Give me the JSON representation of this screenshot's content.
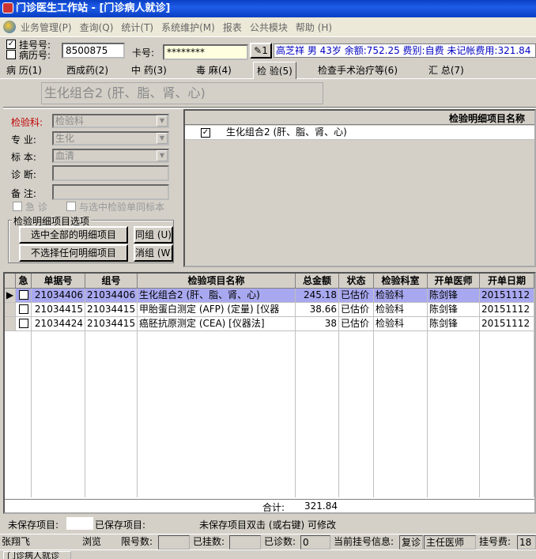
{
  "window": {
    "title": "门诊医生工作站 - [门诊病人就诊]"
  },
  "menu": [
    "业务管理(P)",
    "查询(Q)",
    "统计(T)",
    "系统维护(M)",
    "报表",
    "公共模块",
    "帮助 (H)"
  ],
  "patient": {
    "reg_label": "挂号号:",
    "record_label": "病历号:",
    "record_value": "8500875",
    "card_label": "卡号:",
    "card_value": "********",
    "card_btn": "1",
    "info": "高芝祥 男 43岁 余额:752.25 费别:自费 未记帐费用:321.84"
  },
  "tabs": [
    "病 历(1)",
    "西成药(2)",
    "中 药(3)",
    "毒 麻(4)",
    "检 验(5)",
    "检查手术治疗等(6)",
    "汇 总(7)"
  ],
  "active_tab": 4,
  "current_item_title": "生化组合2 (肝、脂、肾、心)",
  "form": {
    "dept_label": "检验科:",
    "dept_value": "检验科",
    "specialty_label": "专  业:",
    "specialty_value": "生化",
    "specimen_label": "标  本:",
    "specimen_value": "血清",
    "diagnosis_label": "诊  断:",
    "diagnosis_value": "",
    "remark_label": "备  注:",
    "remark_value": "",
    "urgent_label": "急 诊",
    "same_specimen_label": "与选中检验单同标本"
  },
  "options_group": {
    "caption": "检验明细项目选项",
    "select_all": "选中全部的明细项目",
    "select_none": "不选择任何明细项目",
    "same_group": "同组 (U)",
    "cancel_group": "消组 (W)"
  },
  "detail": {
    "header": "检验明细项目名称",
    "rows": [
      {
        "checked": true,
        "name": "生化组合2 (肝、脂、肾、心)"
      }
    ]
  },
  "grid": {
    "columns": [
      "急",
      "单据号",
      "组号",
      "检验项目名称",
      "总金额",
      "状态",
      "检验科室",
      "开单医师",
      "开单日期"
    ],
    "rows": [
      {
        "urgent": false,
        "doc_no": "21034406",
        "group_no": "21034406",
        "name": "生化组合2 (肝、脂、肾、心)",
        "amount": "245.18",
        "status": "已估价",
        "dept": "检验科",
        "doctor": "陈剑锋",
        "date": "20151112"
      },
      {
        "urgent": false,
        "doc_no": "21034415",
        "group_no": "21034415",
        "name": "甲胎蛋白测定 (AFP) (定量) [仪器",
        "amount": "38.66",
        "status": "已估价",
        "dept": "检验科",
        "doctor": "陈剑锋",
        "date": "20151112"
      },
      {
        "urgent": false,
        "doc_no": "21034424",
        "group_no": "21034415",
        "name": "癌胚抗原测定 (CEA) [仪器法]",
        "amount": "38",
        "status": "已估价",
        "dept": "检验科",
        "doctor": "陈剑锋",
        "date": "20151112"
      }
    ],
    "total_label": "合计:",
    "total_value": "321.84"
  },
  "save_status": {
    "unsaved_label": "未保存项目:",
    "saved_label": "已保存项目:",
    "hint": "未保存项目双击 (或右键) 可修改"
  },
  "statusbar": {
    "user": "张翔飞",
    "browse": "浏览",
    "limit_label": "限号数:",
    "limit_value": "",
    "registered_label": "已挂数:",
    "registered_value": "",
    "seen_label": "已诊数:",
    "seen_value": "0",
    "current_label": "当前挂号信息:",
    "visit_type": "复诊",
    "doctor_title": "主任医师",
    "fee_label": "挂号费:",
    "fee_value": "18"
  },
  "taskbar": {
    "item": "门诊病人就诊"
  }
}
